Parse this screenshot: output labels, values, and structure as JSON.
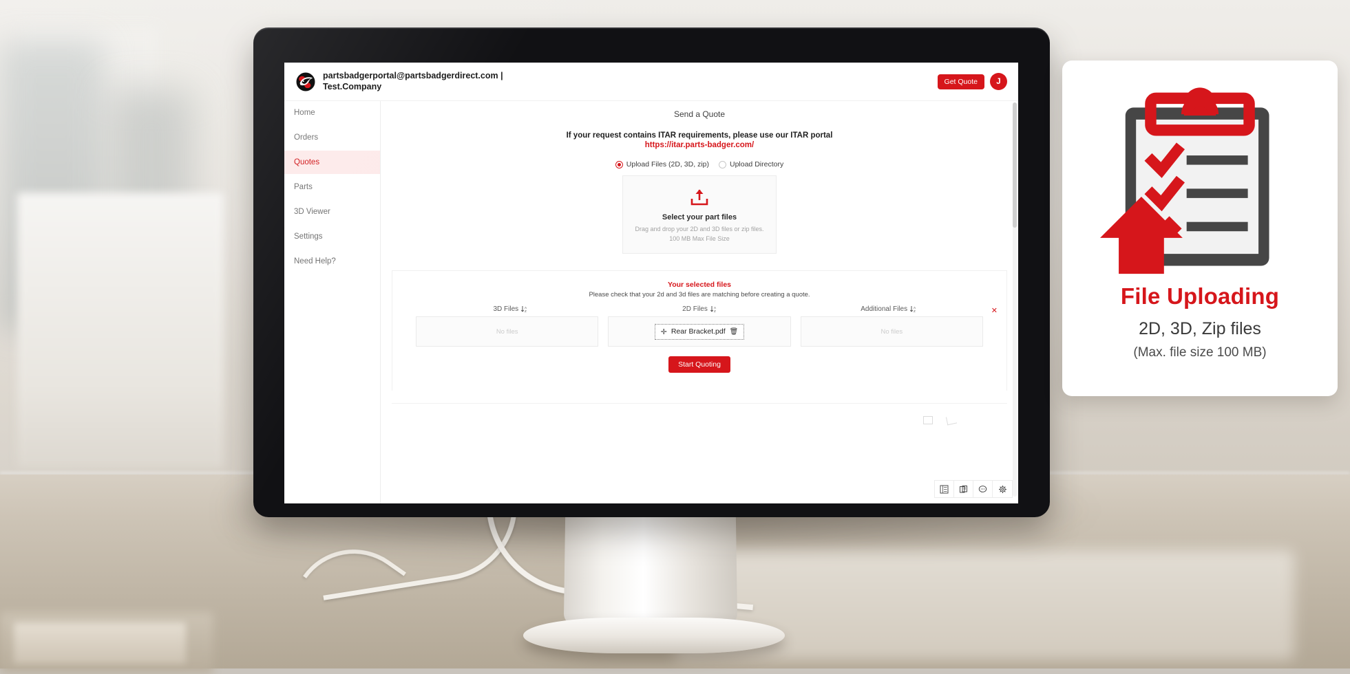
{
  "topbar": {
    "logo_icon": "badger-logo",
    "account_email": "partsbadgerportal@partsbadgerdirect.com |",
    "company": "Test.Company",
    "get_quote_label": "Get Quote",
    "avatar_initial": "J"
  },
  "sidebar": {
    "items": [
      {
        "label": "Home",
        "active": false
      },
      {
        "label": "Orders",
        "active": false
      },
      {
        "label": "Quotes",
        "active": true
      },
      {
        "label": "Parts",
        "active": false
      },
      {
        "label": "3D Viewer",
        "active": false
      },
      {
        "label": "Settings",
        "active": false
      },
      {
        "label": "Need Help?",
        "active": false
      }
    ]
  },
  "main": {
    "page_title": "Send a Quote",
    "itar_notice": "If your request contains ITAR requirements, please use our ITAR portal",
    "itar_url": "https://itar.parts-badger.com/",
    "upload_mode": {
      "options": [
        {
          "label": "Upload Files (2D, 3D, zip)",
          "selected": true
        },
        {
          "label": "Upload Directory",
          "selected": false
        }
      ]
    },
    "dropzone": {
      "icon": "upload-arrow-icon",
      "title": "Select your part files",
      "subtitle_line1": "Drag and drop your 2D and 3D files or zip files.",
      "subtitle_line2": "100 MB Max File Size"
    },
    "selected_files": {
      "title": "Your selected files",
      "subtitle": "Please check that your 2d and 3d files are matching before creating a quote.",
      "columns": [
        {
          "header": "3D Files",
          "empty_label": "No files",
          "files": []
        },
        {
          "header": "2D Files",
          "empty_label": "No files",
          "files": [
            {
              "name": "Rear Bracket.pdf"
            }
          ]
        },
        {
          "header": "Additional Files",
          "empty_label": "No files",
          "files": []
        }
      ],
      "remove_row_label": "✕"
    },
    "start_quoting_label": "Start Quoting"
  },
  "bottom_toolbar": {
    "buttons": [
      {
        "icon": "list-view-icon"
      },
      {
        "icon": "clipboard-icon"
      },
      {
        "icon": "chat-bubble-icon"
      },
      {
        "icon": "gear-icon"
      }
    ]
  },
  "promo": {
    "illustration": "clipboard-upload-illustration",
    "title": "File Uploading",
    "line1": "2D, 3D, Zip files",
    "line2": "(Max. file size 100 MB)"
  },
  "colors": {
    "brand_red": "#d6161b",
    "active_nav_bg": "#fdeaea",
    "clipboard_gray": "#464646",
    "text_dark": "#1f1f1f"
  }
}
